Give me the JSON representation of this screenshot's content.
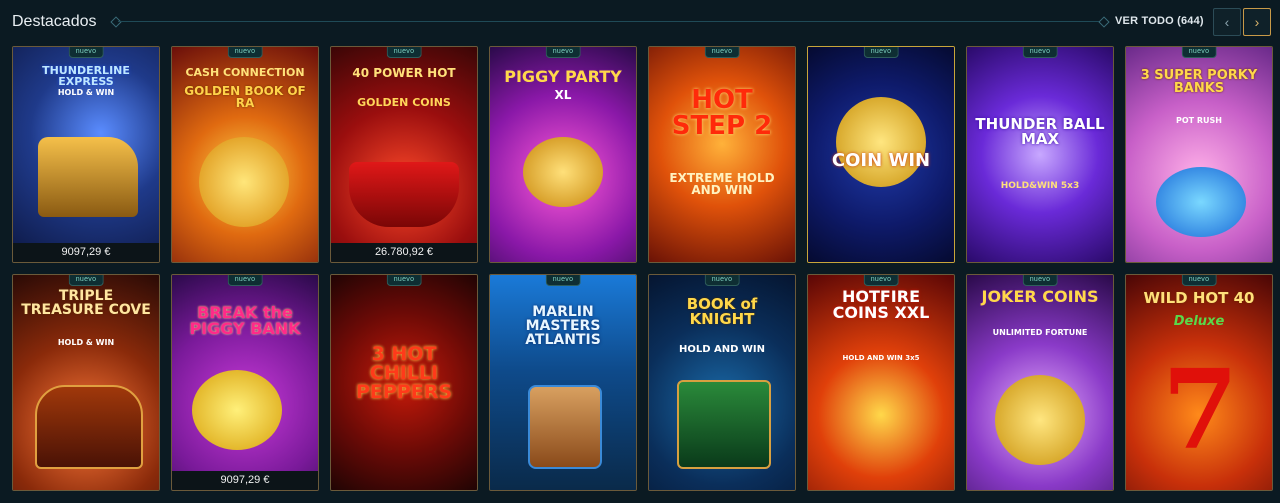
{
  "header": {
    "title": "Destacados",
    "see_all": "VER TODO (644)",
    "prev_icon": "chevron-left-icon",
    "next_icon": "chevron-right-icon"
  },
  "colors": {
    "background": "#0b1a22",
    "accent_gold": "#c89a48",
    "badge_text": "#7fd3c2"
  },
  "games": [
    {
      "title": "THUNDERLINE EXPRESS",
      "subtitle": "HOLD & WIN",
      "badge": "nuevo",
      "jackpot": "9097,29 €"
    },
    {
      "title": "CASH CONNECTION",
      "subtitle": "GOLDEN BOOK OF RA",
      "badge": "nuevo",
      "jackpot": ""
    },
    {
      "title": "40 POWER HOT",
      "subtitle": "GOLDEN COINS",
      "badge": "nuevo",
      "jackpot": "26.780,92 €"
    },
    {
      "title": "PIGGY PARTY",
      "subtitle": "XL",
      "badge": "nuevo",
      "jackpot": ""
    },
    {
      "title": "HOT STEP 2",
      "subtitle": "EXTREME HOLD AND WIN",
      "badge": "nuevo",
      "jackpot": ""
    },
    {
      "title": "COIN WIN",
      "subtitle": "",
      "badge": "nuevo",
      "jackpot": ""
    },
    {
      "title": "THUNDER BALL MAX",
      "subtitle": "HOLD&WIN 5x3",
      "badge": "nuevo",
      "jackpot": ""
    },
    {
      "title": "3 SUPER PORKY BANKS",
      "subtitle": "POT RUSH",
      "badge": "nuevo",
      "jackpot": ""
    },
    {
      "title": "TRIPLE TREASURE COVE",
      "subtitle": "HOLD & WIN",
      "badge": "nuevo",
      "jackpot": ""
    },
    {
      "title": "BREAK the PIGGY BANK",
      "subtitle": "",
      "badge": "nuevo",
      "jackpot": "9097,29 €"
    },
    {
      "title": "3 HOT CHILLI PEPPERS",
      "subtitle": "",
      "badge": "nuevo",
      "jackpot": ""
    },
    {
      "title": "MARLIN MASTERS ATLANTIS",
      "subtitle": "",
      "badge": "nuevo",
      "jackpot": ""
    },
    {
      "title": "BOOK of KNIGHT",
      "subtitle": "HOLD AND WIN",
      "badge": "nuevo",
      "jackpot": ""
    },
    {
      "title": "HOTFIRE COINS XXL",
      "subtitle": "HOLD AND WIN 3x5",
      "badge": "nuevo",
      "jackpot": ""
    },
    {
      "title": "JOKER COINS",
      "subtitle": "UNLIMITED FORTUNE",
      "badge": "nuevo",
      "jackpot": ""
    },
    {
      "title": "WILD HOT 40",
      "subtitle": "Deluxe",
      "badge": "nuevo",
      "jackpot": ""
    }
  ]
}
